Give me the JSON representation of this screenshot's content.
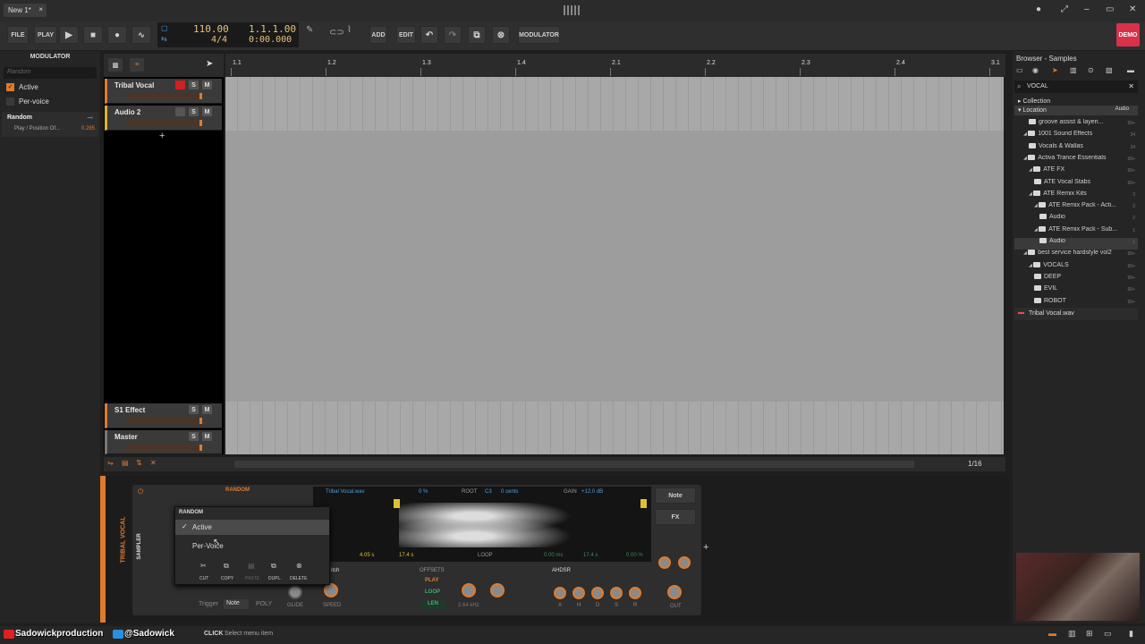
{
  "titlebar": {
    "tab": "New 1*",
    "close": "×"
  },
  "toolbar": {
    "file": "FILE",
    "play": "PLAY",
    "add": "ADD",
    "edit": "EDIT",
    "modulator": "MODULATOR",
    "demo": "DEMO",
    "tempo": "110.00",
    "signature": "4/4",
    "position": "1.1.1.00",
    "time": "0:00.000"
  },
  "modpanel": {
    "title": "MODULATOR",
    "search": "Random",
    "active": "Active",
    "pervoice": "Per-voice",
    "random": "Random",
    "target": "Play / Position Of...",
    "target_value": "0.285"
  },
  "ruler": [
    "1.1",
    "1.2",
    "1.3",
    "1.4",
    "2.1",
    "2.2",
    "2.3",
    "2.4",
    "3.1"
  ],
  "tracks": [
    {
      "name": "Tribal Vocal"
    },
    {
      "name": "Audio 2"
    }
  ],
  "bottom_tracks": [
    {
      "name": "S1 Effect"
    },
    {
      "name": "Master"
    }
  ],
  "sm": {
    "s": "S",
    "m": "M"
  },
  "grid": "1/16",
  "browser": {
    "title": "Browser - Samples",
    "search": "VOCAL",
    "collection": "Collection",
    "location": "Location",
    "audio_tag": "Audio",
    "items": [
      {
        "label": "groove assist & layeri...",
        "n": "99+",
        "d": 2
      },
      {
        "label": "1001 Sound Effects",
        "n": "24",
        "d": 1
      },
      {
        "label": "Vocals & Wallas",
        "n": "24",
        "d": 2
      },
      {
        "label": "Activa Trance Essentials",
        "n": "99+",
        "d": 1
      },
      {
        "label": "ATE FX",
        "n": "99+",
        "d": 2
      },
      {
        "label": "ATE Vocal Stabs",
        "n": "99+",
        "d": 3
      },
      {
        "label": "ATE Remix Kits",
        "n": "3",
        "d": 2
      },
      {
        "label": "ATE Remix Pack - Acti...",
        "n": "2",
        "d": 3
      },
      {
        "label": "Audio",
        "n": "2",
        "d": 4
      },
      {
        "label": "ATE Remix Pack - Sub...",
        "n": "1",
        "d": 3
      },
      {
        "label": "Audio",
        "n": "1",
        "d": 4
      },
      {
        "label": "best service hardstyle vol2",
        "n": "99+",
        "d": 1
      },
      {
        "label": "VOCALS",
        "n": "99+",
        "d": 2
      },
      {
        "label": "DEEP",
        "n": "99+",
        "d": 3
      },
      {
        "label": "EVIL",
        "n": "99+",
        "d": 3
      },
      {
        "label": "ROBOT",
        "n": "99+",
        "d": 3
      }
    ],
    "file": "Tribal Vocal.wav"
  },
  "device": {
    "track_label": "TRIBAL VOCAL",
    "sampler": "SAMPLER",
    "random": "RANDOM",
    "file": "Tribal Vocal.wav",
    "pct": "0 %",
    "root_label": "ROOT",
    "root": "C3",
    "cents": "0 cents",
    "gain_label": "GAIN",
    "gain": "+12.0 dB",
    "note": "Note",
    "fx": "FX",
    "start": "4.05 s",
    "end": "17.4 s",
    "loop": "LOOP",
    "ms": "0.00 ms",
    "loopend": "17.4 s",
    "loopp": "0.00 %",
    "offsets": "OFFSETS",
    "play": "PLAY",
    "loopbtn": "LOOP",
    "len": "LEN",
    "ahdsr": "AHDSR",
    "freq": "2.64 kHz",
    "glide": "GLIDE",
    "speed": "SPEED",
    "trigger": "Trigger",
    "trig_val": "Note",
    "poly": "POLY",
    "out": "OUT",
    "pitch": "itch",
    "env": [
      "A",
      "H",
      "D",
      "S",
      "R"
    ]
  },
  "context": {
    "header": "RANDOM",
    "active": "Active",
    "pervoice": "Per-Voice",
    "cut": "CUT",
    "copy": "COPY",
    "paste": "PASTE",
    "dupl": "DUPL.",
    "delete": "DELETE"
  },
  "status": {
    "yt": "Sadowickproduction",
    "tw": "@Sadowick",
    "click": "CLICK",
    "hint": "Select menu item"
  }
}
